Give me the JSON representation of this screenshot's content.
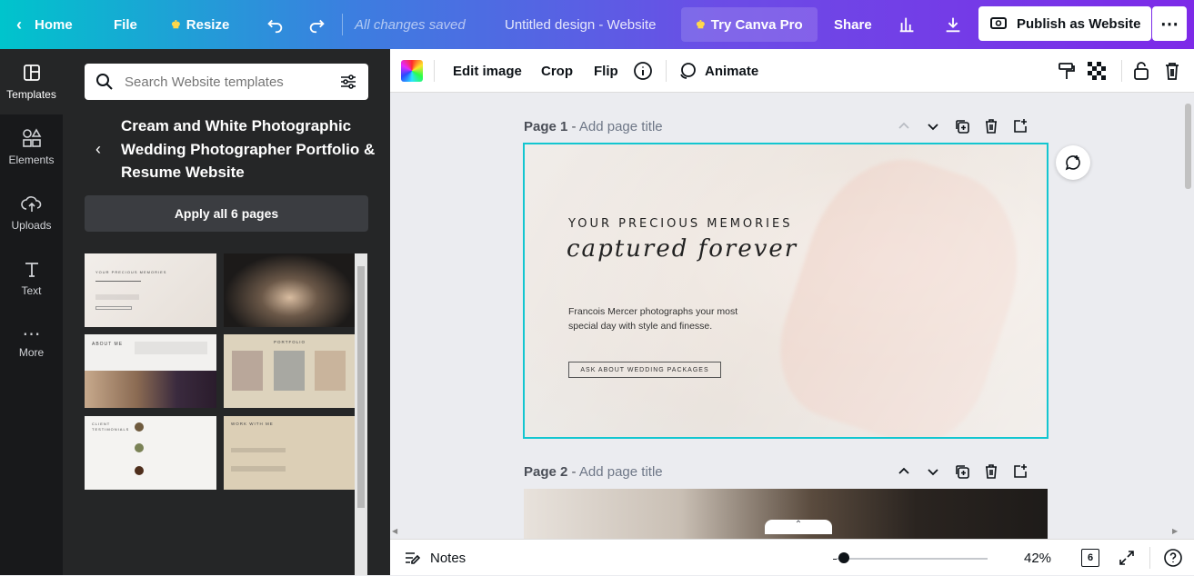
{
  "topbar": {
    "home": "Home",
    "file": "File",
    "resize": "Resize",
    "save_status": "All changes saved",
    "doc_title": "Untitled design - Website",
    "try_pro": "Try Canva Pro",
    "share": "Share",
    "publish": "Publish as Website"
  },
  "rail": {
    "items": [
      {
        "label": "Templates"
      },
      {
        "label": "Elements"
      },
      {
        "label": "Uploads"
      },
      {
        "label": "Text"
      },
      {
        "label": "More"
      }
    ]
  },
  "panel": {
    "search_placeholder": "Search Website templates",
    "template_title": "Cream and White Photographic Wedding Photographer Portfolio & Resume Website",
    "apply_button": "Apply all 6 pages",
    "thumbs": [
      {
        "text": "YOUR PRECIOUS MEMORIES"
      },
      {
        "text": ""
      },
      {
        "text": "ABOUT ME"
      },
      {
        "text": "PORTFOLIO"
      },
      {
        "text": "CLIENT TESTIMONIALS"
      },
      {
        "text": "WORK WITH ME"
      }
    ]
  },
  "toolbar": {
    "edit_image": "Edit image",
    "crop": "Crop",
    "flip": "Flip",
    "animate": "Animate"
  },
  "pages": {
    "page1_label": "Page 1",
    "page2_label": "Page 2",
    "add_title": "Add page title",
    "separator": " - "
  },
  "design": {
    "headline": "YOUR PRECIOUS MEMORIES",
    "script": "captured forever",
    "blurb": "Francois Mercer photographs your most special day with style and finesse.",
    "cta": "ASK ABOUT WEDDING PACKAGES"
  },
  "bottombar": {
    "notes": "Notes",
    "zoom": "42%",
    "page_count": "6",
    "zoom_level": 0.42
  },
  "colors": {
    "accent": "#13c6d0",
    "brand_start": "#00c4cc",
    "brand_end": "#7d2ae8"
  }
}
